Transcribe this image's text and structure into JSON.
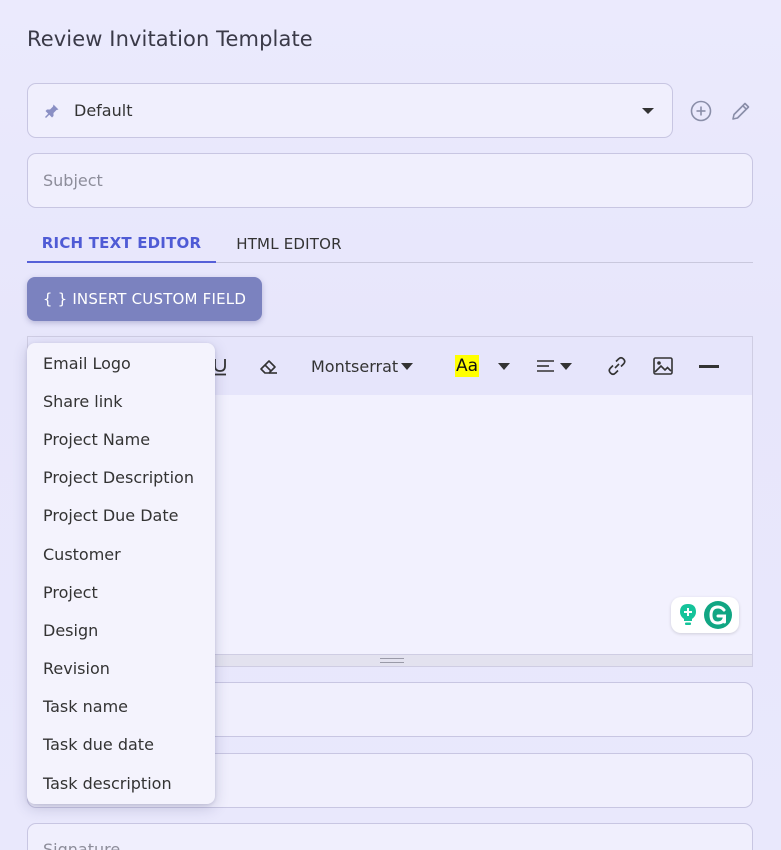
{
  "page": {
    "title": "Review Invitation Template"
  },
  "template_select": {
    "value": "Default"
  },
  "subject": {
    "placeholder": "Subject"
  },
  "tabs": [
    {
      "label": "RICH TEXT EDITOR",
      "active": true
    },
    {
      "label": "HTML EDITOR",
      "active": false
    }
  ],
  "insert_button": {
    "label": "{ } INSERT CUSTOM FIELD"
  },
  "toolbar": {
    "font": "Montserrat",
    "highlight_label": "Aa",
    "highlight_color": "#ffff00"
  },
  "custom_fields_menu": {
    "items": [
      "Email Logo",
      "Share link",
      "Project Name",
      "Project Description",
      "Project Due Date",
      "Customer",
      "Project",
      "Design",
      "Revision",
      "Task name",
      "Task due date",
      "Task description"
    ]
  },
  "fields": {
    "signature_placeholder": "Signature"
  },
  "colors": {
    "accent": "#5660d8",
    "button": "#7b82bf",
    "grammarly": "#15c39a"
  }
}
